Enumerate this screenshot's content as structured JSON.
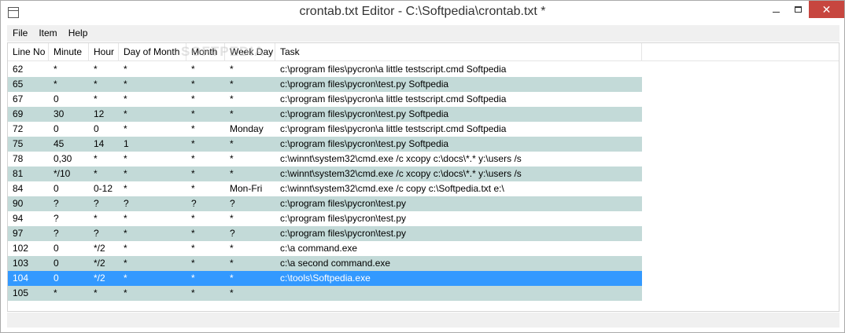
{
  "window": {
    "title": "crontab.txt Editor - C:\\Softpedia\\crontab.txt *",
    "close_glyph": "✕"
  },
  "menu": [
    "File",
    "Item",
    "Help"
  ],
  "watermark": "SOFTPEDIA",
  "columns": [
    "Line No",
    "Minute",
    "Hour",
    "Day of Month",
    "Month",
    "Week Day",
    "Task"
  ],
  "rows": [
    {
      "line": "62",
      "minute": "*",
      "hour": "*",
      "dom": "*",
      "month": "*",
      "weekday": "*",
      "task": "c:\\program files\\pycron\\a little testscript.cmd Softpedia",
      "style": "normal"
    },
    {
      "line": "65",
      "minute": "*",
      "hour": "*",
      "dom": "*",
      "month": "*",
      "weekday": "*",
      "task": "c:\\program files\\pycron\\test.py Softpedia",
      "style": "alt"
    },
    {
      "line": "67",
      "minute": "0",
      "hour": "*",
      "dom": "*",
      "month": "*",
      "weekday": "*",
      "task": "c:\\program files\\pycron\\a little testscript.cmd Softpedia",
      "style": "normal"
    },
    {
      "line": "69",
      "minute": "30",
      "hour": "12",
      "dom": "*",
      "month": "*",
      "weekday": "*",
      "task": "c:\\program files\\pycron\\test.py Softpedia",
      "style": "alt"
    },
    {
      "line": "72",
      "minute": "0",
      "hour": "0",
      "dom": "*",
      "month": "*",
      "weekday": "Monday",
      "task": "c:\\program files\\pycron\\a little testscript.cmd Softpedia",
      "style": "normal"
    },
    {
      "line": "75",
      "minute": "45",
      "hour": "14",
      "dom": "1",
      "month": "*",
      "weekday": "*",
      "task": "c:\\program files\\pycron\\test.py Softpedia",
      "style": "alt"
    },
    {
      "line": "78",
      "minute": "0,30",
      "hour": "*",
      "dom": "*",
      "month": "*",
      "weekday": "*",
      "task": "c:\\winnt\\system32\\cmd.exe /c xcopy c:\\docs\\*.* y:\\users /s",
      "style": "normal"
    },
    {
      "line": "81",
      "minute": "*/10",
      "hour": "*",
      "dom": "*",
      "month": "*",
      "weekday": "*",
      "task": "c:\\winnt\\system32\\cmd.exe /c xcopy c:\\docs\\*.* y:\\users /s",
      "style": "alt"
    },
    {
      "line": "84",
      "minute": "0",
      "hour": "0-12",
      "dom": "*",
      "month": "*",
      "weekday": "Mon-Fri",
      "task": "c:\\winnt\\system32\\cmd.exe /c copy c:\\Softpedia.txt e:\\",
      "style": "normal"
    },
    {
      "line": "90",
      "minute": "?",
      "hour": "?",
      "dom": "?",
      "month": "?",
      "weekday": "?",
      "task": "c:\\program files\\pycron\\test.py",
      "style": "alt"
    },
    {
      "line": "94",
      "minute": "?",
      "hour": "*",
      "dom": "*",
      "month": "*",
      "weekday": "*",
      "task": "c:\\program files\\pycron\\test.py",
      "style": "normal"
    },
    {
      "line": "97",
      "minute": "?",
      "hour": "?",
      "dom": "*",
      "month": "*",
      "weekday": "?",
      "task": "c:\\program files\\pycron\\test.py",
      "style": "alt"
    },
    {
      "line": "102",
      "minute": "0",
      "hour": "*/2",
      "dom": "*",
      "month": "*",
      "weekday": "*",
      "task": "c:\\a command.exe",
      "style": "normal"
    },
    {
      "line": "103",
      "minute": "0",
      "hour": "*/2",
      "dom": "*",
      "month": "*",
      "weekday": "*",
      "task": "c:\\a second command.exe",
      "style": "alt"
    },
    {
      "line": "104",
      "minute": "0",
      "hour": "*/2",
      "dom": "*",
      "month": "*",
      "weekday": "*",
      "task": "c:\\tools\\Softpedia.exe",
      "style": "selected"
    },
    {
      "line": "105",
      "minute": "*",
      "hour": "*",
      "dom": "*",
      "month": "*",
      "weekday": "*",
      "task": "",
      "style": "alt"
    }
  ],
  "colors": {
    "row_alt": "#c3dad8",
    "row_selected": "#3399ff",
    "close_button": "#c7463f"
  }
}
